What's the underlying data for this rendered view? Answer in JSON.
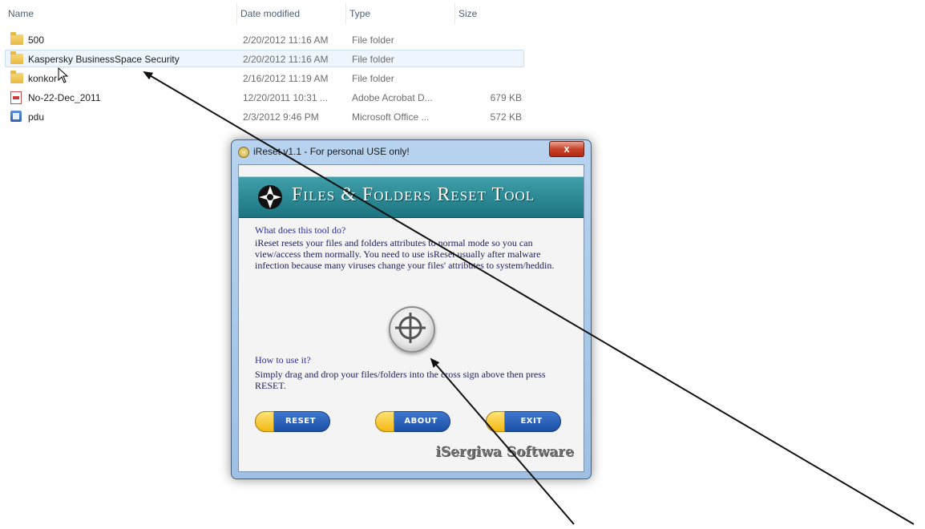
{
  "columns": {
    "name": "Name",
    "date_modified": "Date modified",
    "type": "Type",
    "size": "Size"
  },
  "files": [
    {
      "icon": "folder-icon",
      "name": "500",
      "date": "2/20/2012 11:16 AM",
      "type": "File folder",
      "size": "",
      "selected": false
    },
    {
      "icon": "folder-icon",
      "name": "Kaspersky BusinessSpace Security",
      "date": "2/20/2012 11:16 AM",
      "type": "File folder",
      "size": "",
      "selected": true
    },
    {
      "icon": "folder-icon",
      "name": "konkor",
      "date": "2/16/2012 11:19 AM",
      "type": "File folder",
      "size": "",
      "selected": false
    },
    {
      "icon": "pdf-icon",
      "name": "No-22-Dec_2011",
      "date": "12/20/2011 10:31 ...",
      "type": "Adobe Acrobat D...",
      "size": "679 KB",
      "selected": false
    },
    {
      "icon": "word-doc-icon",
      "name": "pdu",
      "date": "2/3/2012 9:46 PM",
      "type": "Microsoft Office ...",
      "size": "572 KB",
      "selected": false
    }
  ],
  "dialog": {
    "title": "iReset v1.1 - For personal USE only!",
    "close_label": "x",
    "banner_title": "Files & Folders Reset Tool",
    "what_heading": "What does this tool do?",
    "what_body": "iReset resets your files and folders attributes to normal mode so you can view/access them normally. You need to use isReset usually after malware infection because many viruses change your files' attributes to system/heddin.",
    "how_heading": "How to use it?",
    "how_body": "Simply drag and drop your files/folders into the cross sign above then press RESET.",
    "buttons": {
      "reset": "RESET",
      "about": "ABOUT",
      "exit": "EXIT"
    },
    "brand": "iSergiwa Software"
  },
  "colors": {
    "banner": "#2a8e99",
    "button_blue": "#2a5fb8",
    "button_cap": "#f5c21b",
    "heading": "#2c2ca0",
    "close_button": "#c7432a"
  }
}
